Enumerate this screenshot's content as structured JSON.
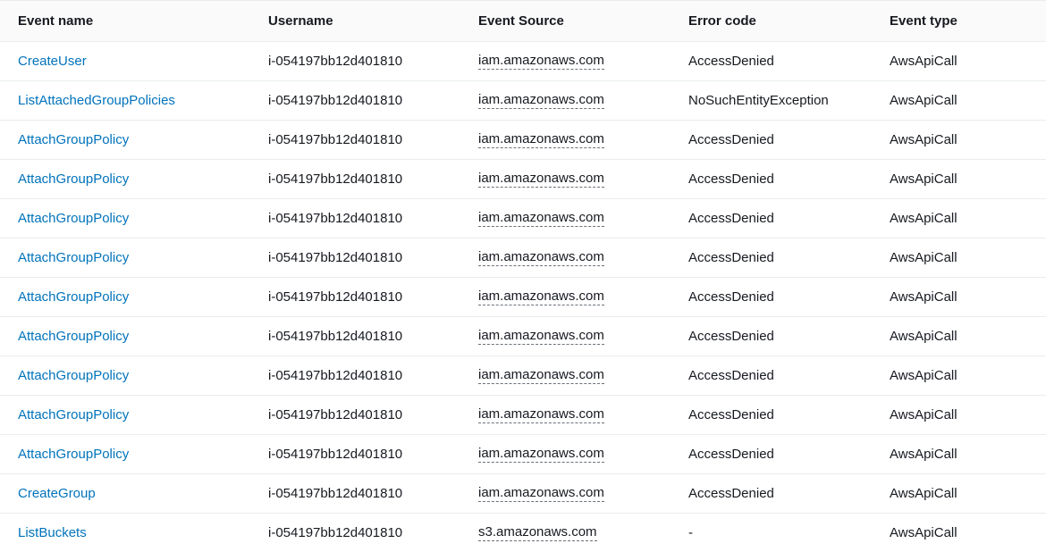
{
  "columns": [
    {
      "key": "event_name",
      "label": "Event name"
    },
    {
      "key": "username",
      "label": "Username"
    },
    {
      "key": "source",
      "label": "Event Source"
    },
    {
      "key": "error",
      "label": "Error code"
    },
    {
      "key": "type",
      "label": "Event type"
    }
  ],
  "rows": [
    {
      "event_name": "CreateUser",
      "username": "i-054197bb12d401810",
      "source": "iam.amazonaws.com",
      "error": "AccessDenied",
      "type": "AwsApiCall"
    },
    {
      "event_name": "ListAttachedGroupPolicies",
      "username": "i-054197bb12d401810",
      "source": "iam.amazonaws.com",
      "error": "NoSuchEntityException",
      "type": "AwsApiCall"
    },
    {
      "event_name": "AttachGroupPolicy",
      "username": "i-054197bb12d401810",
      "source": "iam.amazonaws.com",
      "error": "AccessDenied",
      "type": "AwsApiCall"
    },
    {
      "event_name": "AttachGroupPolicy",
      "username": "i-054197bb12d401810",
      "source": "iam.amazonaws.com",
      "error": "AccessDenied",
      "type": "AwsApiCall"
    },
    {
      "event_name": "AttachGroupPolicy",
      "username": "i-054197bb12d401810",
      "source": "iam.amazonaws.com",
      "error": "AccessDenied",
      "type": "AwsApiCall"
    },
    {
      "event_name": "AttachGroupPolicy",
      "username": "i-054197bb12d401810",
      "source": "iam.amazonaws.com",
      "error": "AccessDenied",
      "type": "AwsApiCall"
    },
    {
      "event_name": "AttachGroupPolicy",
      "username": "i-054197bb12d401810",
      "source": "iam.amazonaws.com",
      "error": "AccessDenied",
      "type": "AwsApiCall"
    },
    {
      "event_name": "AttachGroupPolicy",
      "username": "i-054197bb12d401810",
      "source": "iam.amazonaws.com",
      "error": "AccessDenied",
      "type": "AwsApiCall"
    },
    {
      "event_name": "AttachGroupPolicy",
      "username": "i-054197bb12d401810",
      "source": "iam.amazonaws.com",
      "error": "AccessDenied",
      "type": "AwsApiCall"
    },
    {
      "event_name": "AttachGroupPolicy",
      "username": "i-054197bb12d401810",
      "source": "iam.amazonaws.com",
      "error": "AccessDenied",
      "type": "AwsApiCall"
    },
    {
      "event_name": "AttachGroupPolicy",
      "username": "i-054197bb12d401810",
      "source": "iam.amazonaws.com",
      "error": "AccessDenied",
      "type": "AwsApiCall"
    },
    {
      "event_name": "CreateGroup",
      "username": "i-054197bb12d401810",
      "source": "iam.amazonaws.com",
      "error": "AccessDenied",
      "type": "AwsApiCall"
    },
    {
      "event_name": "ListBuckets",
      "username": "i-054197bb12d401810",
      "source": "s3.amazonaws.com",
      "error": "-",
      "type": "AwsApiCall"
    }
  ],
  "colors": {
    "link": "#0073bb",
    "border": "#eaeded",
    "header_bg": "#fafafa",
    "text": "#16191f"
  }
}
